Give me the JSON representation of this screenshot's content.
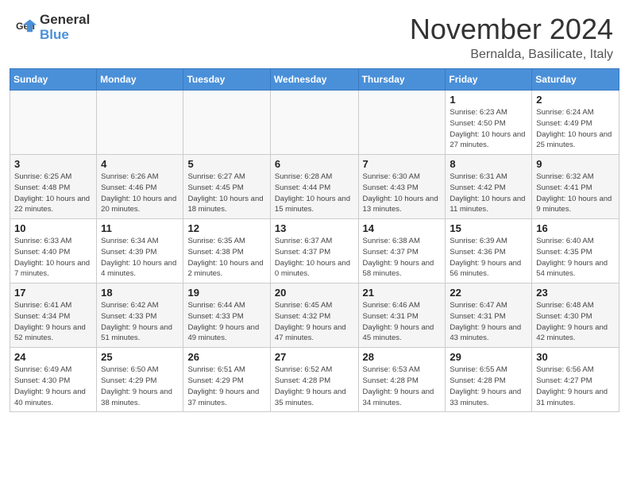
{
  "header": {
    "logo_line1": "General",
    "logo_line2": "Blue",
    "title": "November 2024",
    "subtitle": "Bernalda, Basilicate, Italy"
  },
  "weekdays": [
    "Sunday",
    "Monday",
    "Tuesday",
    "Wednesday",
    "Thursday",
    "Friday",
    "Saturday"
  ],
  "weeks": [
    [
      {
        "day": "",
        "info": ""
      },
      {
        "day": "",
        "info": ""
      },
      {
        "day": "",
        "info": ""
      },
      {
        "day": "",
        "info": ""
      },
      {
        "day": "",
        "info": ""
      },
      {
        "day": "1",
        "info": "Sunrise: 6:23 AM\nSunset: 4:50 PM\nDaylight: 10 hours and 27 minutes."
      },
      {
        "day": "2",
        "info": "Sunrise: 6:24 AM\nSunset: 4:49 PM\nDaylight: 10 hours and 25 minutes."
      }
    ],
    [
      {
        "day": "3",
        "info": "Sunrise: 6:25 AM\nSunset: 4:48 PM\nDaylight: 10 hours and 22 minutes."
      },
      {
        "day": "4",
        "info": "Sunrise: 6:26 AM\nSunset: 4:46 PM\nDaylight: 10 hours and 20 minutes."
      },
      {
        "day": "5",
        "info": "Sunrise: 6:27 AM\nSunset: 4:45 PM\nDaylight: 10 hours and 18 minutes."
      },
      {
        "day": "6",
        "info": "Sunrise: 6:28 AM\nSunset: 4:44 PM\nDaylight: 10 hours and 15 minutes."
      },
      {
        "day": "7",
        "info": "Sunrise: 6:30 AM\nSunset: 4:43 PM\nDaylight: 10 hours and 13 minutes."
      },
      {
        "day": "8",
        "info": "Sunrise: 6:31 AM\nSunset: 4:42 PM\nDaylight: 10 hours and 11 minutes."
      },
      {
        "day": "9",
        "info": "Sunrise: 6:32 AM\nSunset: 4:41 PM\nDaylight: 10 hours and 9 minutes."
      }
    ],
    [
      {
        "day": "10",
        "info": "Sunrise: 6:33 AM\nSunset: 4:40 PM\nDaylight: 10 hours and 7 minutes."
      },
      {
        "day": "11",
        "info": "Sunrise: 6:34 AM\nSunset: 4:39 PM\nDaylight: 10 hours and 4 minutes."
      },
      {
        "day": "12",
        "info": "Sunrise: 6:35 AM\nSunset: 4:38 PM\nDaylight: 10 hours and 2 minutes."
      },
      {
        "day": "13",
        "info": "Sunrise: 6:37 AM\nSunset: 4:37 PM\nDaylight: 10 hours and 0 minutes."
      },
      {
        "day": "14",
        "info": "Sunrise: 6:38 AM\nSunset: 4:37 PM\nDaylight: 9 hours and 58 minutes."
      },
      {
        "day": "15",
        "info": "Sunrise: 6:39 AM\nSunset: 4:36 PM\nDaylight: 9 hours and 56 minutes."
      },
      {
        "day": "16",
        "info": "Sunrise: 6:40 AM\nSunset: 4:35 PM\nDaylight: 9 hours and 54 minutes."
      }
    ],
    [
      {
        "day": "17",
        "info": "Sunrise: 6:41 AM\nSunset: 4:34 PM\nDaylight: 9 hours and 52 minutes."
      },
      {
        "day": "18",
        "info": "Sunrise: 6:42 AM\nSunset: 4:33 PM\nDaylight: 9 hours and 51 minutes."
      },
      {
        "day": "19",
        "info": "Sunrise: 6:44 AM\nSunset: 4:33 PM\nDaylight: 9 hours and 49 minutes."
      },
      {
        "day": "20",
        "info": "Sunrise: 6:45 AM\nSunset: 4:32 PM\nDaylight: 9 hours and 47 minutes."
      },
      {
        "day": "21",
        "info": "Sunrise: 6:46 AM\nSunset: 4:31 PM\nDaylight: 9 hours and 45 minutes."
      },
      {
        "day": "22",
        "info": "Sunrise: 6:47 AM\nSunset: 4:31 PM\nDaylight: 9 hours and 43 minutes."
      },
      {
        "day": "23",
        "info": "Sunrise: 6:48 AM\nSunset: 4:30 PM\nDaylight: 9 hours and 42 minutes."
      }
    ],
    [
      {
        "day": "24",
        "info": "Sunrise: 6:49 AM\nSunset: 4:30 PM\nDaylight: 9 hours and 40 minutes."
      },
      {
        "day": "25",
        "info": "Sunrise: 6:50 AM\nSunset: 4:29 PM\nDaylight: 9 hours and 38 minutes."
      },
      {
        "day": "26",
        "info": "Sunrise: 6:51 AM\nSunset: 4:29 PM\nDaylight: 9 hours and 37 minutes."
      },
      {
        "day": "27",
        "info": "Sunrise: 6:52 AM\nSunset: 4:28 PM\nDaylight: 9 hours and 35 minutes."
      },
      {
        "day": "28",
        "info": "Sunrise: 6:53 AM\nSunset: 4:28 PM\nDaylight: 9 hours and 34 minutes."
      },
      {
        "day": "29",
        "info": "Sunrise: 6:55 AM\nSunset: 4:28 PM\nDaylight: 9 hours and 33 minutes."
      },
      {
        "day": "30",
        "info": "Sunrise: 6:56 AM\nSunset: 4:27 PM\nDaylight: 9 hours and 31 minutes."
      }
    ]
  ]
}
